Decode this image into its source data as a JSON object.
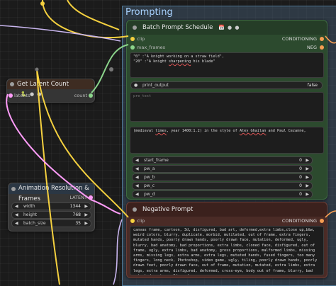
{
  "group": {
    "title": "Prompting"
  },
  "batch_prompt_schedule": {
    "title": "Batch Prompt Schedule",
    "badges": "📅 ● ●",
    "inputs": {
      "clip": "clip",
      "max_frames": "max_frames"
    },
    "outputs": {
      "conditioning": "CONDITIONING",
      "neg": "NEG"
    },
    "text_line1_a": "\"0\" :\"A knight working on a straw field\",",
    "text_line2_a": "\"20\" :\"A knight ",
    "text_line2_b": "sharpening",
    "text_line2_c": " his",
    "text_line2_d": " blade\"",
    "print_output_label": "print_output",
    "print_output_value": "false",
    "pre_text_placeholder": "pre_text",
    "app_text_a": "(medieval ",
    "app_text_b": "times",
    "app_text_c": ", year 1400:1.2) in the style of ",
    "app_text_d": "Atey Ghailan",
    "app_text_e": " and Paul Cezanne,",
    "widgets": [
      {
        "label": "start_frame",
        "value": "0"
      },
      {
        "label": "pw_a",
        "value": "0"
      },
      {
        "label": "pw_b",
        "value": "0"
      },
      {
        "label": "pw_c",
        "value": "0"
      },
      {
        "label": "pw_d",
        "value": "0"
      }
    ]
  },
  "get_latent_count": {
    "title": "Get Latent Count",
    "badges": "🐍 ● ●",
    "input_label": "latents",
    "output_label": "count"
  },
  "animation_resolution": {
    "title": "Animation Resolution & Frames",
    "output_label": "LATENT",
    "widgets": [
      {
        "label": "width",
        "value": "1344"
      },
      {
        "label": "height",
        "value": "768"
      },
      {
        "label": "batch_size",
        "value": "35"
      }
    ]
  },
  "negative_prompt": {
    "title": "Negative Prompt",
    "input_label": "clip",
    "output_label": "CONDITIONING",
    "text": "canvas frame, cartoon, 3d, disfigured, bad art, deformed,extra limbs,close up,b&w, weird colors, blurry, duplicate, morbid, mutilated, out of frame, extra fingers, mutated hands, poorly drawn hands, poorly drawn face, mutation, deformed, ugly, blurry, bad anatomy, bad proportions, extra limbs, cloned face, disfigured, out of frame, ugly, extra limbs, bad anatomy, gross proportions, malformed limbs, missing arms, missing legs, extra arms, extra legs, mutated hands, fused fingers, too many fingers, long neck, Photoshop, video game, ugly, tiling, poorly drawn hands, poorly drawn feet, poorly drawn face, out of frame, mutation, mutated, extra limbs, extra legs, extra arms, disfigured, deformed, cross-eye, body out of frame, blurry, bad art, bad anatomy, 3d render"
  },
  "colors": {
    "clip_wire": "#f4d03f",
    "latent_wire": "#ff9cf9",
    "int_wire": "#8bd48b",
    "group_bg": "#465f78",
    "node_green": "#2c4a2e",
    "node_red": "#4a2b26"
  }
}
